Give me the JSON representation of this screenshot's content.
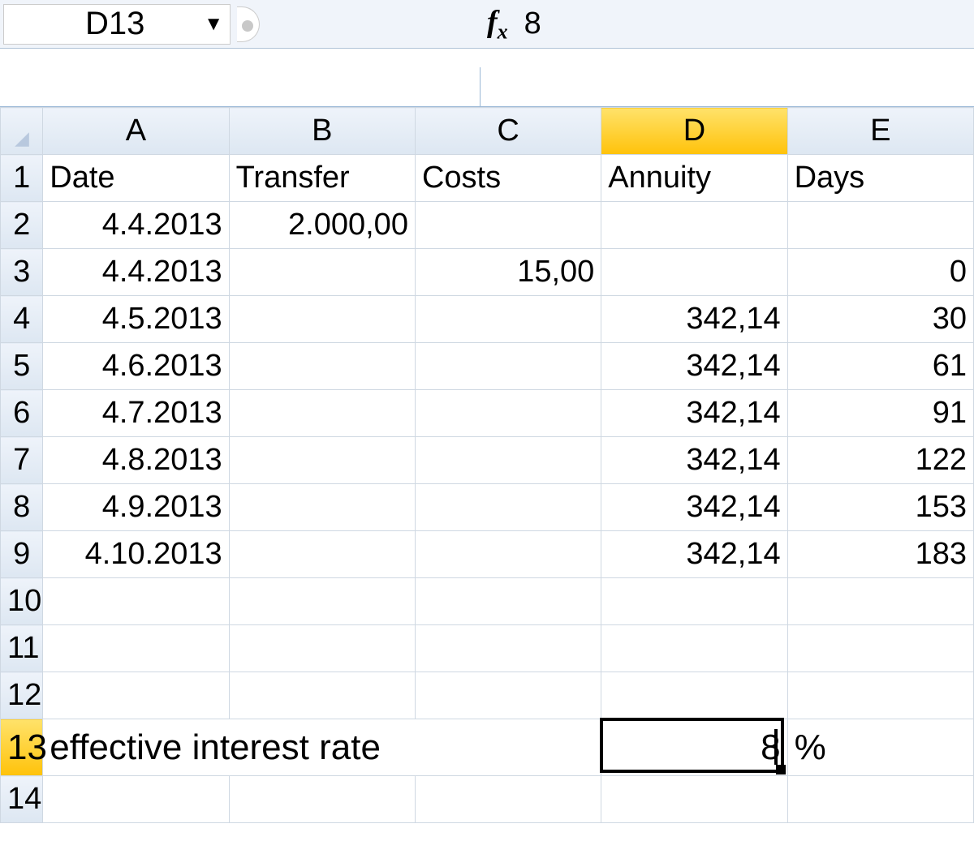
{
  "formula_bar": {
    "cell_ref": "D13",
    "fx_label": "f",
    "fx_sub": "x",
    "value": "8"
  },
  "columns": [
    "A",
    "B",
    "C",
    "D",
    "E"
  ],
  "rows": [
    "1",
    "2",
    "3",
    "4",
    "5",
    "6",
    "7",
    "8",
    "9",
    "10",
    "11",
    "12",
    "13",
    "14"
  ],
  "selected": {
    "col": "D",
    "row": "13"
  },
  "headers": {
    "A": "Date",
    "B": "Transfer",
    "C": "Costs",
    "D": "Annuity",
    "E": "Days"
  },
  "cells": {
    "A2": "4.4.2013",
    "B2": "2.000,00",
    "A3": "4.4.2013",
    "C3": "15,00",
    "E3": "0",
    "A4": "4.5.2013",
    "D4": "342,14",
    "E4": "30",
    "A5": "4.6.2013",
    "D5": "342,14",
    "E5": "61",
    "A6": "4.7.2013",
    "D6": "342,14",
    "E6": "91",
    "A7": "4.8.2013",
    "D7": "342,14",
    "E7": "122",
    "A8": "4.9.2013",
    "D8": "342,14",
    "E8": "153",
    "A9": "4.10.2013",
    "D9": "342,14",
    "E9": "183",
    "A13": "effective interest rate",
    "D13": "8",
    "E13": "%"
  }
}
